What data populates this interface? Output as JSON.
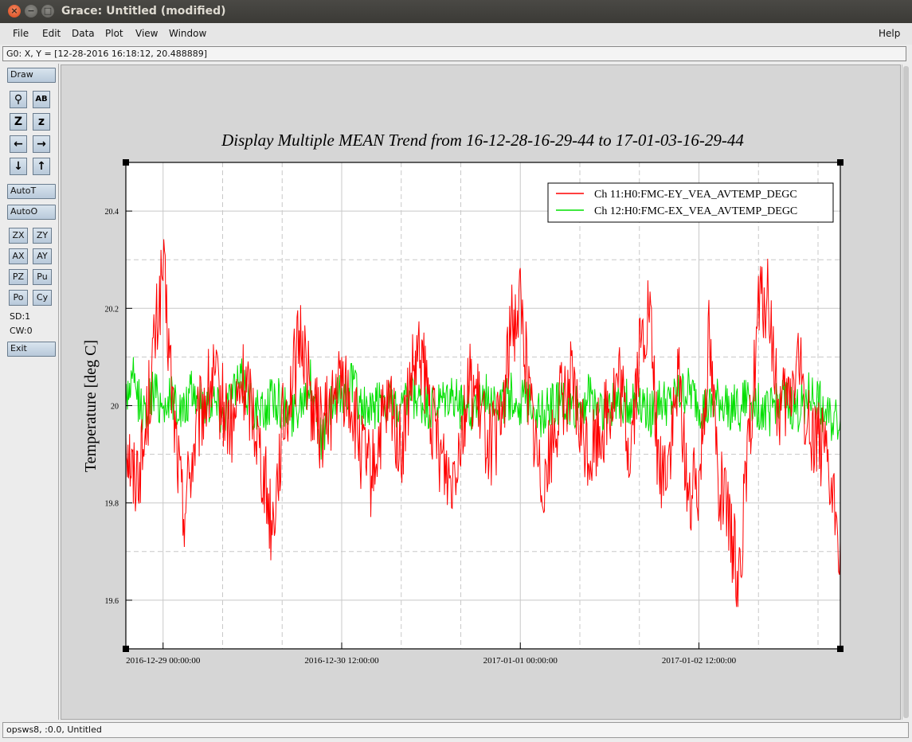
{
  "window": {
    "title": "Grace: Untitled (modified)",
    "buttons": {
      "close": "×",
      "minimize": "−",
      "maximize": "□"
    }
  },
  "menu": {
    "left": [
      "File",
      "Edit",
      "Data",
      "Plot",
      "View",
      "Window"
    ],
    "help": "Help"
  },
  "coord_readout": "G0: X, Y = [12-28-2016 16:18:12, 20.488889]",
  "toolbar": {
    "draw": "Draw",
    "icons": [
      {
        "glyph": "⚲",
        "name": "zoom-glass-icon"
      },
      {
        "glyph": "AB",
        "name": "text-icon"
      },
      {
        "glyph": "Z",
        "name": "zoom-in-icon"
      },
      {
        "glyph": "z",
        "name": "zoom-out-icon"
      },
      {
        "glyph": "←",
        "name": "arrow-left-icon"
      },
      {
        "glyph": "→",
        "name": "arrow-right-icon"
      },
      {
        "glyph": "↓",
        "name": "arrow-down-icon"
      },
      {
        "glyph": "↑",
        "name": "arrow-up-icon"
      }
    ],
    "autot": "AutoT",
    "autoo": "AutoO",
    "small": [
      "ZX",
      "ZY",
      "AX",
      "AY",
      "PZ",
      "Pu",
      "Po",
      "Cy"
    ],
    "sd": "SD:1",
    "cw": "CW:0",
    "exit": "Exit"
  },
  "status": "opsws8, :0.0, Untitled",
  "colors": {
    "series1": "#ff0000",
    "series2": "#00e000",
    "grid": "#c8c8c8"
  },
  "chart_data": {
    "type": "line",
    "title": "Display Multiple MEAN Trend from 16-12-28-16-29-44 to 17-01-03-16-29-44",
    "xlabel": "",
    "ylabel": "Temperature [deg C]",
    "xlim": [
      "2016-12-28 16:29:44",
      "2017-01-03 16:29:44"
    ],
    "ylim": [
      19.5,
      20.5
    ],
    "x_ticks": [
      "2016-12-29 00:00:00",
      "2016-12-30 12:00:00",
      "2017-01-01 00:00:00",
      "2017-01-02 12:00:00"
    ],
    "y_ticks": [
      "19.6",
      "19.8",
      "20",
      "20.2",
      "20.4"
    ],
    "grid": true,
    "legend_position": "top-right",
    "series": [
      {
        "name": "Ch 11:H0:FMC-EY_VEA_AVTEMP_DEGC",
        "color": "#ff0000",
        "x": [
          "2016-12-28 16:29:44",
          "2016-12-28 18:00",
          "2016-12-28 20:00",
          "2016-12-28 22:00",
          "2016-12-29 00:00",
          "2016-12-29 02:00",
          "2016-12-29 04:00",
          "2016-12-29 06:00",
          "2016-12-29 08:00",
          "2016-12-29 10:00",
          "2016-12-29 12:00",
          "2016-12-29 14:00",
          "2016-12-29 16:00",
          "2016-12-29 18:00",
          "2016-12-29 20:00",
          "2016-12-29 22:00",
          "2016-12-30 00:00",
          "2016-12-30 02:00",
          "2016-12-30 04:00",
          "2016-12-30 06:00",
          "2016-12-30 08:00",
          "2016-12-30 10:00",
          "2016-12-30 12:00",
          "2016-12-30 14:00",
          "2016-12-30 16:00",
          "2016-12-30 18:00",
          "2016-12-30 20:00",
          "2016-12-30 22:00",
          "2016-12-31 00:00",
          "2016-12-31 02:00",
          "2016-12-31 04:00",
          "2016-12-31 06:00",
          "2016-12-31 08:00",
          "2016-12-31 10:00",
          "2016-12-31 12:00",
          "2016-12-31 14:00",
          "2016-12-31 16:00",
          "2016-12-31 18:00",
          "2016-12-31 20:00",
          "2016-12-31 22:00",
          "2017-01-01 00:00",
          "2017-01-01 02:00",
          "2017-01-01 04:00",
          "2017-01-01 06:00",
          "2017-01-01 08:00",
          "2017-01-01 10:00",
          "2017-01-01 12:00",
          "2017-01-01 14:00",
          "2017-01-01 16:00",
          "2017-01-01 18:00",
          "2017-01-01 20:00",
          "2017-01-01 22:00",
          "2017-01-02 00:00",
          "2017-01-02 02:00",
          "2017-01-02 04:00",
          "2017-01-02 06:00",
          "2017-01-02 08:00",
          "2017-01-02 10:00",
          "2017-01-02 12:00",
          "2017-01-02 14:00",
          "2017-01-02 16:00",
          "2017-01-02 18:00",
          "2017-01-02 20:00",
          "2017-01-02 22:00",
          "2017-01-03 00:00",
          "2017-01-03 02:00",
          "2017-01-03 04:00",
          "2017-01-03 06:00",
          "2017-01-03 08:00",
          "2017-01-03 10:00",
          "2017-01-03 12:00",
          "2017-01-03 14:00",
          "2017-01-03 16:29:44"
        ],
        "values": [
          19.95,
          19.85,
          19.9,
          20.1,
          20.28,
          20.0,
          19.78,
          19.9,
          20.0,
          20.05,
          20.0,
          19.95,
          20.05,
          20.0,
          19.88,
          19.75,
          19.95,
          20.05,
          20.15,
          20.0,
          19.95,
          20.0,
          20.05,
          20.0,
          19.9,
          19.85,
          19.95,
          20.0,
          19.9,
          20.05,
          20.1,
          19.98,
          19.9,
          19.85,
          19.95,
          20.05,
          19.98,
          19.92,
          19.95,
          20.15,
          20.22,
          20.0,
          19.85,
          19.9,
          20.0,
          20.05,
          19.95,
          19.9,
          19.95,
          20.0,
          20.05,
          19.9,
          20.1,
          20.2,
          19.85,
          19.9,
          20.05,
          19.8,
          19.85,
          20.15,
          19.85,
          19.75,
          19.65,
          19.9,
          20.2,
          20.22,
          19.98,
          20.0,
          20.1,
          19.95,
          19.95,
          19.85,
          19.72
        ]
      },
      {
        "name": "Ch 12:H0:FMC-EX_VEA_AVTEMP_DEGC",
        "color": "#00e000",
        "x": [
          "2016-12-28 16:29:44",
          "2016-12-28 18:00",
          "2016-12-28 20:00",
          "2016-12-28 22:00",
          "2016-12-29 00:00",
          "2016-12-29 02:00",
          "2016-12-29 04:00",
          "2016-12-29 06:00",
          "2016-12-29 08:00",
          "2016-12-29 10:00",
          "2016-12-29 12:00",
          "2016-12-29 14:00",
          "2016-12-29 16:00",
          "2016-12-29 18:00",
          "2016-12-29 20:00",
          "2016-12-29 22:00",
          "2016-12-30 00:00",
          "2016-12-30 02:00",
          "2016-12-30 04:00",
          "2016-12-30 06:00",
          "2016-12-30 08:00",
          "2016-12-30 10:00",
          "2016-12-30 12:00",
          "2016-12-30 14:00",
          "2016-12-30 16:00",
          "2016-12-30 18:00",
          "2016-12-30 20:00",
          "2016-12-30 22:00",
          "2016-12-31 00:00",
          "2016-12-31 02:00",
          "2016-12-31 04:00",
          "2016-12-31 06:00",
          "2016-12-31 08:00",
          "2016-12-31 10:00",
          "2016-12-31 12:00",
          "2016-12-31 14:00",
          "2016-12-31 16:00",
          "2016-12-31 18:00",
          "2016-12-31 20:00",
          "2016-12-31 22:00",
          "2017-01-01 00:00",
          "2017-01-01 02:00",
          "2017-01-01 04:00",
          "2017-01-01 06:00",
          "2017-01-01 08:00",
          "2017-01-01 10:00",
          "2017-01-01 12:00",
          "2017-01-01 14:00",
          "2017-01-01 16:00",
          "2017-01-01 18:00",
          "2017-01-01 20:00",
          "2017-01-01 22:00",
          "2017-01-02 00:00",
          "2017-01-02 02:00",
          "2017-01-02 04:00",
          "2017-01-02 06:00",
          "2017-01-02 08:00",
          "2017-01-02 10:00",
          "2017-01-02 12:00",
          "2017-01-02 14:00",
          "2017-01-02 16:00",
          "2017-01-02 18:00",
          "2017-01-02 20:00",
          "2017-01-02 22:00",
          "2017-01-03 00:00",
          "2017-01-03 02:00",
          "2017-01-03 04:00",
          "2017-01-03 06:00",
          "2017-01-03 08:00",
          "2017-01-03 10:00",
          "2017-01-03 12:00",
          "2017-01-03 14:00",
          "2017-01-03 16:29:44"
        ],
        "values": [
          20.02,
          20.05,
          19.98,
          20.03,
          20.0,
          20.02,
          19.98,
          20.03,
          20.0,
          20.02,
          19.98,
          20.03,
          20.05,
          20.0,
          19.98,
          20.02,
          20.0,
          19.98,
          20.02,
          20.05,
          19.92,
          20.0,
          20.02,
          20.05,
          20.0,
          19.98,
          20.02,
          20.0,
          19.98,
          20.02,
          20.0,
          19.99,
          20.0,
          20.02,
          20.0,
          19.99,
          20.01,
          20.03,
          20.0,
          20.02,
          20.0,
          20.02,
          19.98,
          20.0,
          20.01,
          19.99,
          20.0,
          20.02,
          20.0,
          19.99,
          20.02,
          20.0,
          20.02,
          19.98,
          20.01,
          20.0,
          20.02,
          20.03,
          20.0,
          19.99,
          20.01,
          20.0,
          19.99,
          20.02,
          20.0,
          19.98,
          20.02,
          20.0,
          19.99,
          20.02,
          20.01,
          19.97,
          19.97
        ]
      }
    ]
  }
}
